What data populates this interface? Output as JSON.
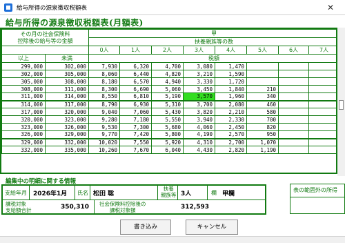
{
  "window": {
    "title": "給与所得の源泉徴収税額表",
    "close_glyph": "✕"
  },
  "heading": "給与所得の源泉徴収税額表(月額表)",
  "table": {
    "corner_label_1": "その月の社会保険料",
    "corner_label_2": "控除後の給与等の金額",
    "col_ko": "甲",
    "dependents_header": "扶養親族等の数",
    "dependent_cols": [
      "0人",
      "1人",
      "2人",
      "3人",
      "4人",
      "5人",
      "6人",
      "7人"
    ],
    "lower_label": "以上",
    "upper_label": "未満",
    "tax_label": "税額",
    "rows": [
      [
        "299,000",
        "302,000",
        "7,930",
        "6,320",
        "4,700",
        "3,080",
        "1,470",
        "",
        "",
        ""
      ],
      [
        "302,000",
        "305,000",
        "8,060",
        "6,440",
        "4,820",
        "3,210",
        "1,590",
        "",
        "",
        ""
      ],
      [
        "305,000",
        "308,000",
        "8,180",
        "6,570",
        "4,940",
        "3,330",
        "1,720",
        "",
        "",
        ""
      ],
      [
        "308,000",
        "311,000",
        "8,300",
        "6,690",
        "5,060",
        "3,450",
        "1,840",
        "210",
        "",
        ""
      ],
      [
        "311,000",
        "314,000",
        "8,550",
        "6,810",
        "5,190",
        "3,570",
        "1,960",
        "340",
        "",
        ""
      ],
      [
        "314,000",
        "317,000",
        "8,790",
        "6,930",
        "5,310",
        "3,700",
        "2,080",
        "460",
        "",
        ""
      ],
      [
        "317,000",
        "320,000",
        "9,040",
        "7,060",
        "5,430",
        "3,820",
        "2,210",
        "580",
        "",
        ""
      ],
      [
        "320,000",
        "323,000",
        "9,280",
        "7,180",
        "5,550",
        "3,940",
        "2,330",
        "700",
        "",
        ""
      ],
      [
        "323,000",
        "326,000",
        "9,530",
        "7,300",
        "5,680",
        "4,060",
        "2,450",
        "820",
        "",
        ""
      ],
      [
        "326,000",
        "329,000",
        "9,770",
        "7,420",
        "5,800",
        "4,190",
        "2,570",
        "950",
        "",
        ""
      ],
      [
        "329,000",
        "332,000",
        "10,020",
        "7,550",
        "5,920",
        "4,310",
        "2,700",
        "1,070",
        "",
        ""
      ],
      [
        "332,000",
        "335,000",
        "10,260",
        "7,670",
        "6,040",
        "4,430",
        "2,820",
        "1,190",
        "",
        ""
      ]
    ],
    "highlight": {
      "row": 4,
      "col": 5
    }
  },
  "edit": {
    "section_label": "編集中の明細に関する情報",
    "pay_month_label": "支給年月",
    "pay_month": "2026年1月",
    "name_label": "氏名",
    "name": "松田 聡",
    "dependents_label_1": "扶養",
    "dependents_label_2": "親族等",
    "dependents": "3人",
    "column_label": "欄",
    "column": "甲欄",
    "taxable_label_1": "課税対象",
    "taxable_label_2": "支給額合計",
    "taxable_total": "350,310",
    "after_insurance_label_1": "社会保険料控除後の",
    "after_insurance_label_2": "課税対象額",
    "after_insurance": "312,593"
  },
  "side_panel": {
    "label": "表の範囲外の所得"
  },
  "buttons": {
    "write": "書き込み",
    "cancel": "キャンセル"
  },
  "colors": {
    "accent_green": "#117a11",
    "highlight": "#33dd22"
  }
}
